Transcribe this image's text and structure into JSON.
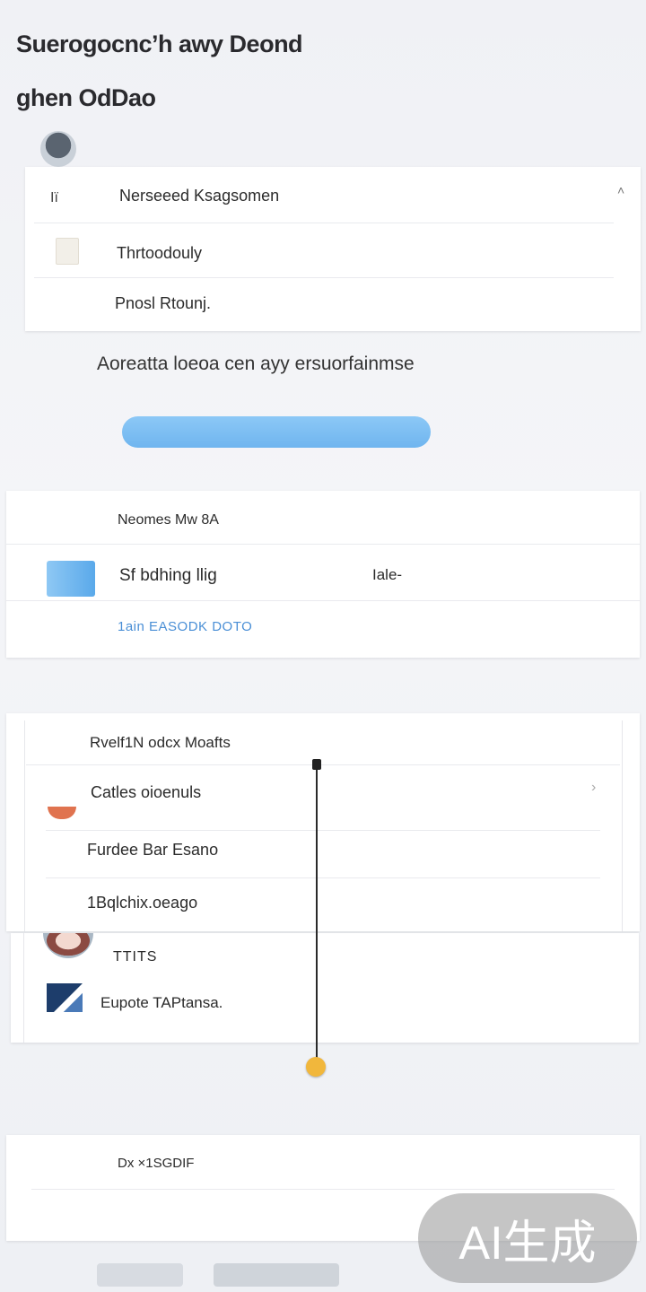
{
  "header": {
    "title_line1": "Suerogocnc’h awy Deond",
    "title_line2": "ghen OdDao"
  },
  "card1": {
    "header_icon": "file-icon",
    "header_icon_text": "Iï",
    "title": "Nerseeed Ksagsomen",
    "row1": "Thrtoodouly",
    "row2": "Pnosl Rtounj."
  },
  "caption": "Aoreatta loeoa cen ayy ersuorfainmse",
  "progress": {
    "value_percent": 100,
    "color": "#7bbdf2"
  },
  "card2": {
    "title": "Neomes Mw 8A",
    "item_label": "Sf bdhing llig",
    "item_value": "Iale-",
    "link": "1ain EASODK DOTO"
  },
  "card3": {
    "title": "Rvelf1N odcx Moafts",
    "row1": "Catles oioenuls",
    "row2": "Furdee Bar Esano",
    "row3": "1Bqlchix.oeago"
  },
  "card4": {
    "row1": "TTITS",
    "row2": "Eupote TAPtansa."
  },
  "card5": {
    "title": "Dx ×1SGDIF"
  },
  "watermark": "AI生成",
  "colors": {
    "accent": "#7bbdf2",
    "link": "#4a8fd6",
    "marker": "#f1b73c",
    "chevron": "#e0734f"
  }
}
